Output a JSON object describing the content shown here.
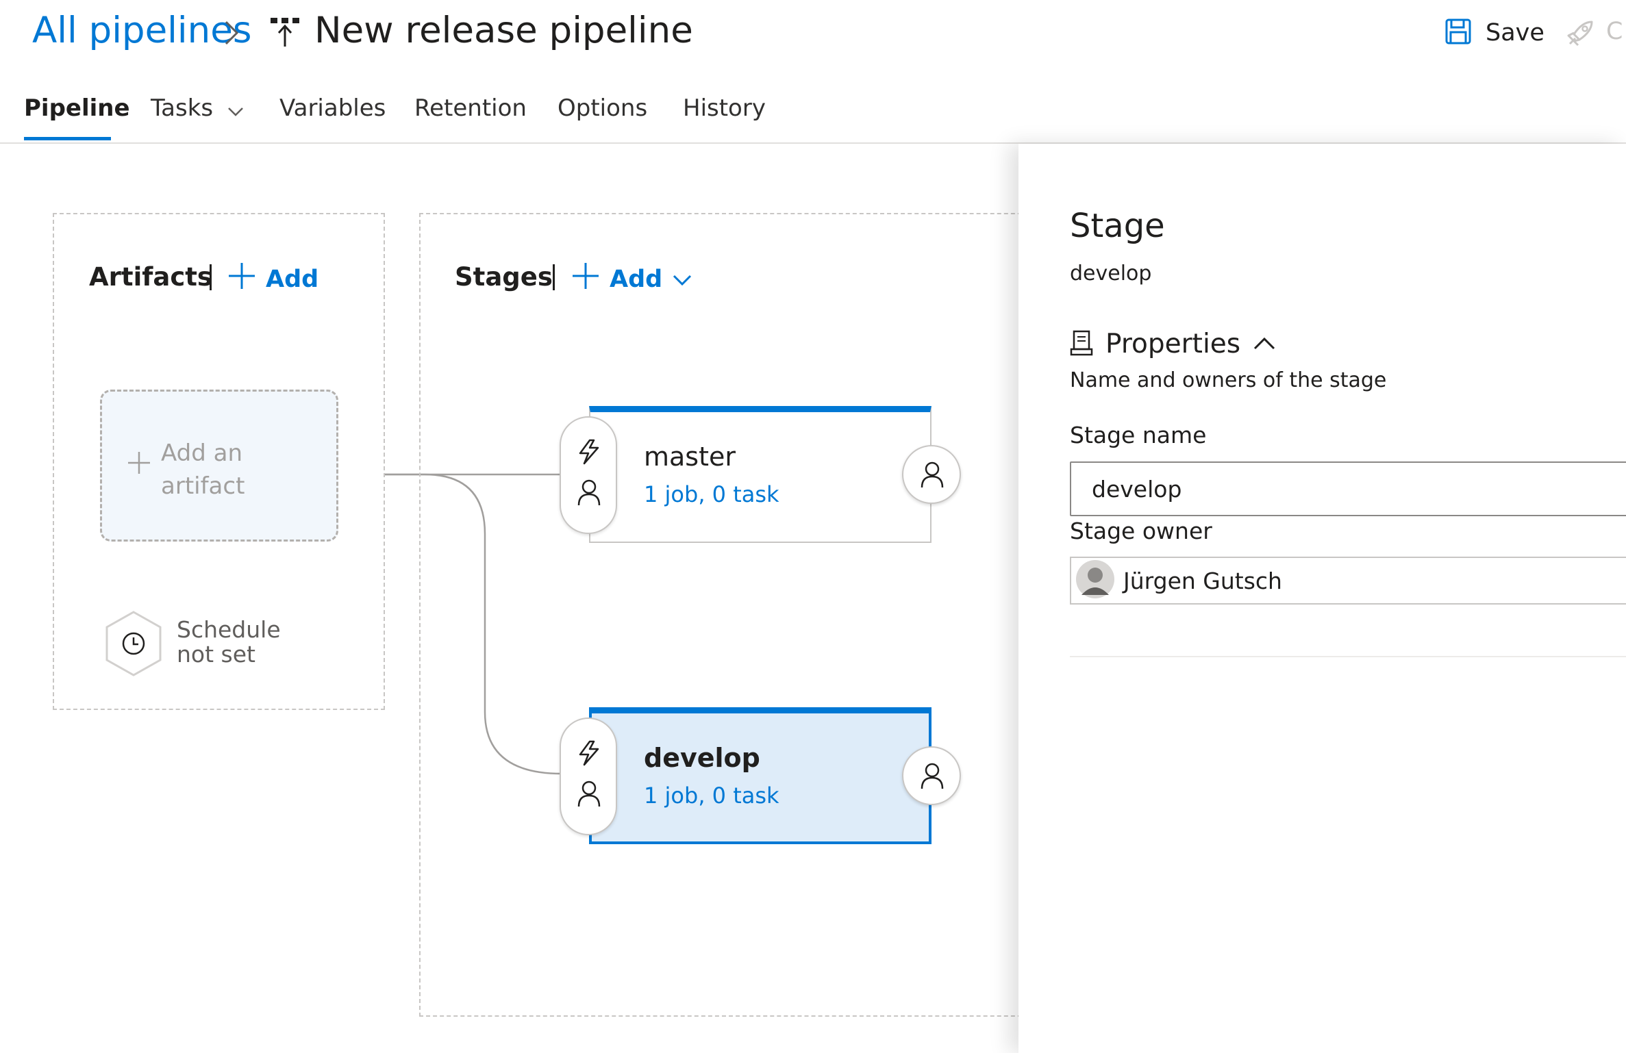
{
  "header": {
    "breadcrumb_link": "All pipelines",
    "breadcrumb_separator": ">",
    "pipeline_icon": "release-pipeline-icon",
    "title": "New release pipeline",
    "save_label": "Save",
    "save_icon": "floppy-disk-icon",
    "release_icon": "rocket-icon",
    "cutoff_label": "C"
  },
  "tabs": [
    {
      "label": "Pipeline",
      "active": true
    },
    {
      "label": "Tasks",
      "has_dropdown": true
    },
    {
      "label": "Variables"
    },
    {
      "label": "Retention"
    },
    {
      "label": "Options"
    },
    {
      "label": "History"
    }
  ],
  "artifacts": {
    "title": "Artifacts",
    "add_label": "Add",
    "placeholder_line1": "Add an",
    "placeholder_line2": "artifact",
    "schedule_line1": "Schedule",
    "schedule_line2": "not set"
  },
  "stages": {
    "title": "Stages",
    "add_label": "Add",
    "items": [
      {
        "name": "master",
        "summary": "1 job, 0 task",
        "selected": false
      },
      {
        "name": "develop",
        "summary": "1 job, 0 task",
        "selected": true
      }
    ]
  },
  "panel": {
    "title": "Stage",
    "subtitle": "develop",
    "section_label": "Properties",
    "section_description": "Name and owners of the stage",
    "stage_name_label": "Stage name",
    "stage_name_value": "develop",
    "stage_owner_label": "Stage owner",
    "stage_owner_value": "Jürgen Gutsch"
  },
  "colors": {
    "accent": "#0078d4",
    "selected_card_bg": "#deecf9",
    "artifact_card_bg": "#f2f7fc"
  }
}
